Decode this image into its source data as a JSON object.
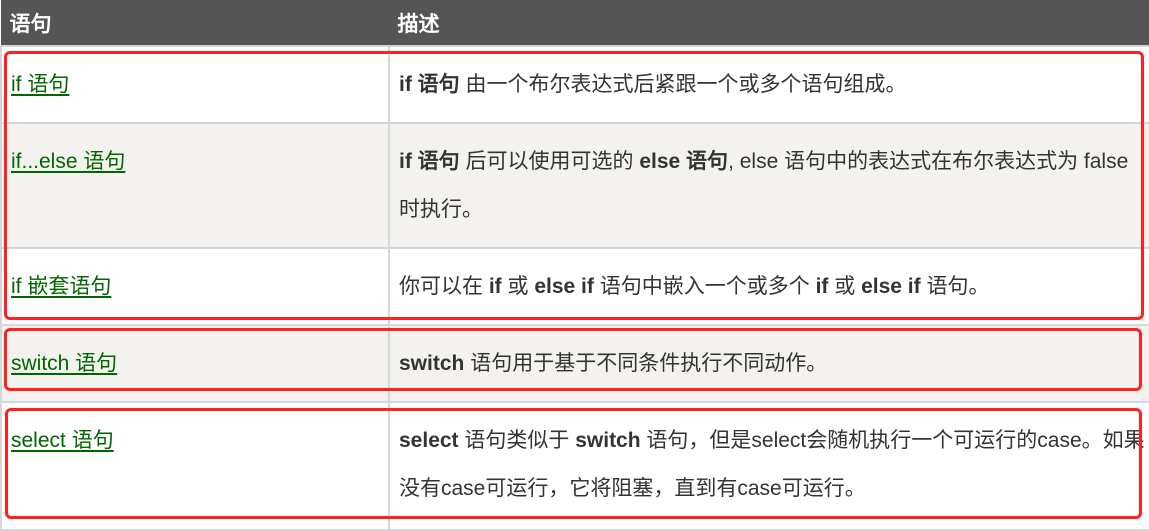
{
  "table": {
    "headers": [
      "语句",
      "描述"
    ],
    "rows": [
      {
        "statement": "if 语句",
        "desc": [
          {
            "t": "if 语句",
            "b": true
          },
          {
            "t": " 由一个布尔表达式后紧跟一个或多个语句组成。",
            "b": false
          }
        ]
      },
      {
        "statement": "if...else 语句",
        "desc": [
          {
            "t": "if 语句",
            "b": true
          },
          {
            "t": " 后可以使用可选的 ",
            "b": false
          },
          {
            "t": "else 语句",
            "b": true
          },
          {
            "t": ", else 语句中的表达式在布尔表达式为 false 时执行。",
            "b": false
          }
        ]
      },
      {
        "statement": "if 嵌套语句",
        "desc": [
          {
            "t": "你可以在 ",
            "b": false
          },
          {
            "t": "if",
            "b": true
          },
          {
            "t": " 或 ",
            "b": false
          },
          {
            "t": "else if",
            "b": true
          },
          {
            "t": " 语句中嵌入一个或多个 ",
            "b": false
          },
          {
            "t": "if",
            "b": true
          },
          {
            "t": " 或 ",
            "b": false
          },
          {
            "t": "else if",
            "b": true
          },
          {
            "t": " 语句。",
            "b": false
          }
        ]
      },
      {
        "statement": "switch 语句",
        "desc": [
          {
            "t": "switch",
            "b": true
          },
          {
            "t": " 语句用于基于不同条件执行不同动作。",
            "b": false
          }
        ]
      },
      {
        "statement": "select 语句",
        "desc": [
          {
            "t": "select",
            "b": true
          },
          {
            "t": " 语句类似于 ",
            "b": false
          },
          {
            "t": "switch",
            "b": true
          },
          {
            "t": " 语句，但是select会随机执行一个可运行的case。如果没有case可运行，它将阻塞，直到有case可运行。",
            "b": false
          }
        ]
      }
    ]
  },
  "highlight_color": "#ff2020",
  "link_color": "#006600",
  "header_bg": "#555555"
}
